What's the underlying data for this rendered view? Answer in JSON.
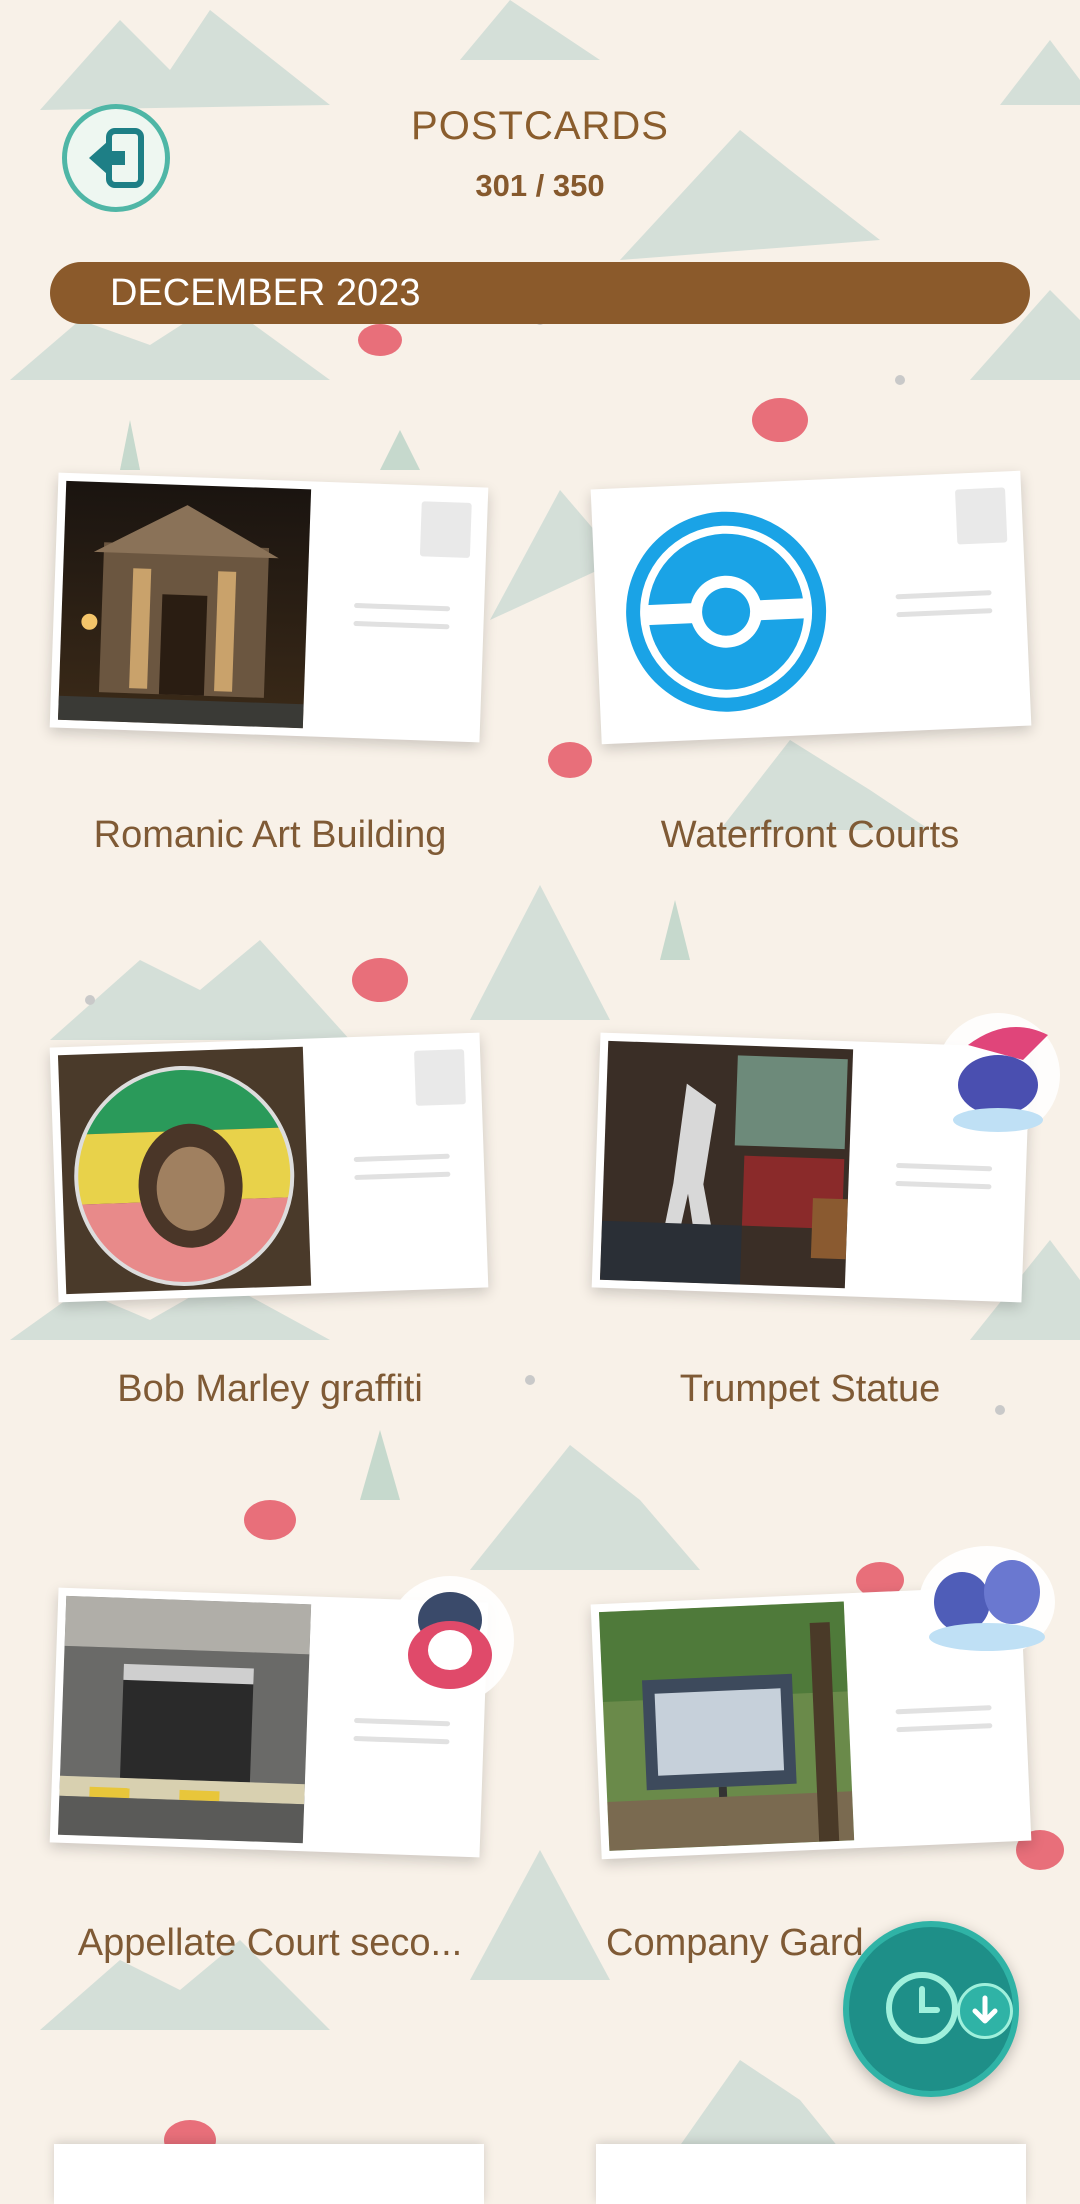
{
  "header": {
    "title": "POSTCARDS",
    "count": "301 / 350",
    "exit_icon": "exit-door-icon"
  },
  "month_section": {
    "label": "DECEMBER 2023"
  },
  "postcards": [
    {
      "name": "Romanic Art Building",
      "photo": "night building facade"
    },
    {
      "name": "Waterfront Courts",
      "photo": "pokestop-icon"
    },
    {
      "name": "Bob Marley graffiti",
      "photo": "painted round sign"
    },
    {
      "name": "Trumpet Statue",
      "photo": "metal statue"
    },
    {
      "name": "Appellate Court seco...",
      "photo": "building entrance"
    },
    {
      "name": "Company Gard...",
      "photo": "park sign board"
    }
  ],
  "fab": {
    "icon": "clock-icon",
    "badge_icon": "download-arrow-icon"
  },
  "colors": {
    "background": "#f8f1e8",
    "month_bar": "#8b5a2b",
    "text": "#7f5a35",
    "accent": "#2fb3a6"
  }
}
